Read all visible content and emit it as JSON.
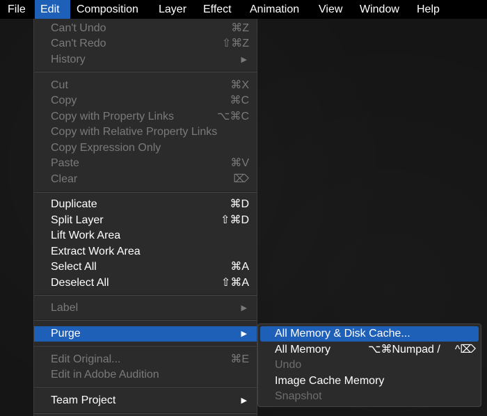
{
  "menubar": {
    "items": [
      {
        "label": "File"
      },
      {
        "label": "Edit"
      },
      {
        "label": "Composition"
      },
      {
        "label": "Layer"
      },
      {
        "label": "Effect"
      },
      {
        "label": "Animation"
      },
      {
        "label": "View"
      },
      {
        "label": "Window"
      },
      {
        "label": "Help"
      }
    ]
  },
  "edit_menu": {
    "items": [
      {
        "label": "Can't Undo",
        "shortcut": "⌘Z",
        "enabled": false
      },
      {
        "label": "Can't Redo",
        "shortcut": "⇧⌘Z",
        "enabled": false
      },
      {
        "label": "History",
        "shortcut": "",
        "submenu_arrow": "▶",
        "enabled": false
      },
      {
        "label": "Cut",
        "shortcut": "⌘X",
        "enabled": false
      },
      {
        "label": "Copy",
        "shortcut": "⌘C",
        "enabled": false
      },
      {
        "label": "Copy with Property Links",
        "shortcut": "⌥⌘C",
        "enabled": false
      },
      {
        "label": "Copy with Relative Property Links",
        "shortcut": "",
        "enabled": false
      },
      {
        "label": "Copy Expression Only",
        "shortcut": "",
        "enabled": false
      },
      {
        "label": "Paste",
        "shortcut": "⌘V",
        "enabled": false
      },
      {
        "label": "Clear",
        "shortcut": "⌦",
        "enabled": false
      },
      {
        "label": "Duplicate",
        "shortcut": "⌘D",
        "enabled": true
      },
      {
        "label": "Split Layer",
        "shortcut": "⇧⌘D",
        "enabled": true
      },
      {
        "label": "Lift Work Area",
        "shortcut": "",
        "enabled": true
      },
      {
        "label": "Extract Work Area",
        "shortcut": "",
        "enabled": true
      },
      {
        "label": "Select All",
        "shortcut": "⌘A",
        "enabled": true
      },
      {
        "label": "Deselect All",
        "shortcut": "⇧⌘A",
        "enabled": true
      },
      {
        "label": "Label",
        "shortcut": "",
        "submenu_arrow": "▶",
        "enabled": false
      },
      {
        "label": "Purge",
        "shortcut": "",
        "submenu_arrow": "▶",
        "enabled": true,
        "highlighted": true
      },
      {
        "label": "Edit Original...",
        "shortcut": "⌘E",
        "enabled": false
      },
      {
        "label": "Edit in Adobe Audition",
        "shortcut": "",
        "enabled": false
      },
      {
        "label": "Team Project",
        "shortcut": "",
        "submenu_arrow": "▶",
        "enabled": true
      }
    ]
  },
  "purge_submenu": {
    "items": [
      {
        "label": "All Memory & Disk Cache...",
        "shortcut": "",
        "enabled": true,
        "highlighted": true
      },
      {
        "label": "All Memory",
        "shortcut": "⌥⌘Numpad /",
        "shortcut_alt": "^⌦",
        "enabled": true
      },
      {
        "label": "Undo",
        "shortcut": "",
        "enabled": false
      },
      {
        "label": "Image Cache Memory",
        "shortcut": "",
        "enabled": true
      },
      {
        "label": "Snapshot",
        "shortcut": "",
        "enabled": false
      }
    ]
  },
  "colors": {
    "highlight": "#1e5fb8",
    "menu_bg": "#2b2b2b",
    "menubar_bg": "#000000",
    "disabled_text": "#7a7a7a"
  }
}
